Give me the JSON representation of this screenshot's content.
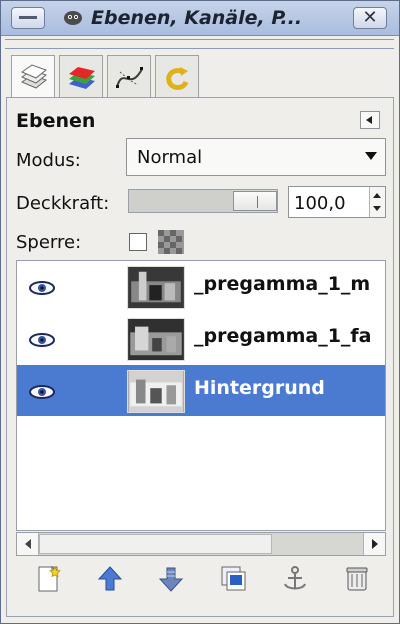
{
  "window": {
    "title": "Ebenen, Kanäle, P...",
    "close_symbol": "✕"
  },
  "icons": {
    "window_menu": "window-menu-icon",
    "app": "gimp-icon",
    "close": "close-icon",
    "layers_tab": "layers-tab-icon",
    "channels_tab": "channels-tab-icon",
    "paths_tab": "paths-tab-icon",
    "undo_tab": "undo-history-tab-icon",
    "panel_menu": "panel-menu-icon",
    "eye": "eye-icon",
    "lock_alpha": "alpha-lock-icon",
    "new_layer": "new-layer-icon",
    "raise": "raise-layer-icon",
    "lower": "lower-layer-icon",
    "duplicate": "duplicate-layer-icon",
    "anchor": "anchor-layer-icon",
    "delete": "delete-layer-icon"
  },
  "panel": {
    "title": "Ebenen",
    "mode_label": "Modus:",
    "mode_value": "Normal",
    "opacity_label": "Deckkraft:",
    "opacity_value": "100,0",
    "opacity_fraction": 1.0,
    "lock_label": "Sperre:"
  },
  "layers": [
    {
      "name": "_pregamma_1_m",
      "visible": true,
      "selected": false
    },
    {
      "name": "_pregamma_1_fa",
      "visible": true,
      "selected": false
    },
    {
      "name": "Hintergrund",
      "visible": true,
      "selected": true
    }
  ],
  "colors": {
    "selection": "#4a7bd1",
    "title_bar": "#b9c8e4",
    "accent_blue": "#2a5fc4"
  }
}
